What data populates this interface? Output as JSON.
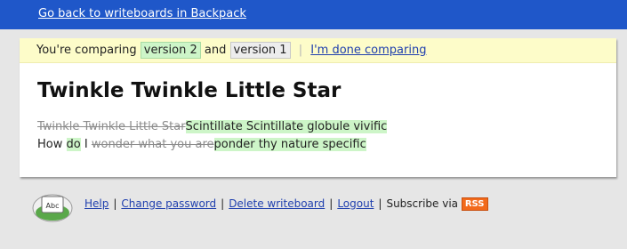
{
  "topbar": {
    "back_link": "Go back to writeboards in Backpack"
  },
  "compare": {
    "prefix": "You're comparing",
    "version_a": "version 2",
    "conjunction": "and",
    "version_b": "version 1",
    "done_link": "I'm done comparing"
  },
  "document": {
    "title": "Twinkle Twinkle Little Star",
    "line1": {
      "deleted": "Twinkle Twinkle Little Star",
      "inserted": "Scintillate Scintillate globule vivific"
    },
    "line2": {
      "text_how": "How",
      "inserted_do": "do",
      "text_i": "I",
      "deleted": "wonder what you are",
      "inserted": "ponder thy nature specific"
    }
  },
  "footer": {
    "logo_text": "Abc",
    "help": "Help",
    "change_password": "Change password",
    "delete_writeboard": "Delete writeboard",
    "logout": "Logout",
    "subscribe": "Subscribe via",
    "rss": "RSS"
  },
  "colors": {
    "topbar": "#1f57c9",
    "compare_bar": "#fdfcc9",
    "inserted_highlight": "#cdf5c8",
    "deleted_text": "#8c8c8c",
    "link": "#1f3fae",
    "rss_badge": "#f26a1b"
  }
}
